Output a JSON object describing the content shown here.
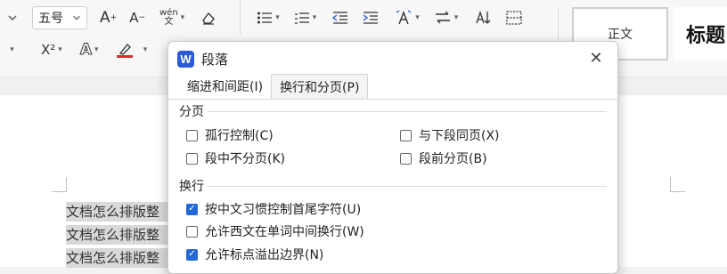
{
  "ribbon": {
    "font_size_value": "五号",
    "increase_font_label": "A",
    "decrease_font_label": "A",
    "phonetic_label": "wén",
    "superscript_label": "X²",
    "outline_text_label": "A",
    "style_normal_label": "正文",
    "style_heading_label": "标题",
    "highlight_color": "#d32f2f"
  },
  "dialog": {
    "app_logo_letter": "W",
    "title": "段落",
    "close_glyph": "✕",
    "tabs": [
      {
        "label": "缩进和间距(I)",
        "active": false
      },
      {
        "label": "换行和分页(P)",
        "active": true
      }
    ],
    "pagination": {
      "title": "分页",
      "options": [
        {
          "label": "孤行控制(C)",
          "checked": false
        },
        {
          "label": "与下段同页(X)",
          "checked": false
        },
        {
          "label": "段中不分页(K)",
          "checked": false
        },
        {
          "label": "段前分页(B)",
          "checked": false
        }
      ]
    },
    "line_break": {
      "title": "换行",
      "options": [
        {
          "label": "按中文习惯控制首尾字符(U)",
          "checked": true
        },
        {
          "label": "允许西文在单词中间换行(W)",
          "checked": false
        },
        {
          "label": "允许标点溢出边界(N)",
          "checked": true
        }
      ]
    }
  },
  "document": {
    "lines": [
      "文档怎么排版整",
      "文档怎么排版整",
      "文档怎么排版整"
    ]
  }
}
